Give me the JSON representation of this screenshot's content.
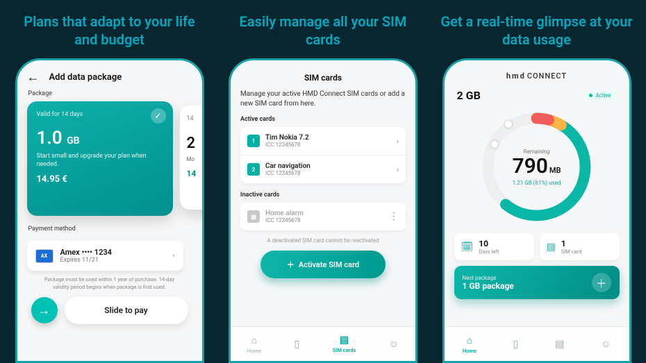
{
  "screen1": {
    "headline": "Plans that adapt to your life and budget",
    "back_icon": "←",
    "title": "Add data package",
    "package_label": "Package",
    "card_selected": {
      "valid": "Valid for 14 days",
      "size_num": "1.0",
      "size_unit": "GB",
      "desc": "Start small and upgrade your plan when needed.",
      "price": "14.95 €"
    },
    "card_peek": {
      "valid_short": "14",
      "size_num": "2",
      "desc_short": "Mo",
      "price_short": "14"
    },
    "payment_label": "Payment method",
    "payment": {
      "logo_text": "AX",
      "name": "Amex •••• 1234",
      "expires": "Expires 11/21"
    },
    "disclaimer": "Package must be used within 1 year of purchase. 14-day validity period begins when package is first used.",
    "slide_label": "Slide to pay",
    "arrow": "→"
  },
  "screen2": {
    "headline": "Easily manage all your SIM cards",
    "title": "SIM cards",
    "intro": "Manage your active HMD Connect SIM cards or add a new SIM card from here.",
    "active_label": "Active cards",
    "active": [
      {
        "idx": "1",
        "name": "Tim Nokia 7.2",
        "icc": "ICC 12345678"
      },
      {
        "idx": "2",
        "name": "Car navigation",
        "icc": "ICC 12345678"
      }
    ],
    "inactive_label": "Inactive cards",
    "inactive": [
      {
        "name": "Home alarm",
        "icc": "ICC 12345678"
      }
    ],
    "note": "A deactivated SIM card cannot be reactivated",
    "activate_label": "Activate SIM card",
    "nav": {
      "home": "Home",
      "mid1": "",
      "sim": "SIM cards",
      "profile": ""
    }
  },
  "screen3": {
    "headline": "Get a real-time glimpse at your data usage",
    "brand_bold": "hmd",
    "brand_light": "CONNECT",
    "plan_size": "2 GB",
    "status_label": "Active",
    "donut": {
      "remaining_label": "Remaining",
      "value": "790",
      "unit": "MB",
      "used_text": "1.21 GB (61%) used"
    },
    "info": {
      "days_value": "10",
      "days_label": "Days left",
      "sim_value": "1",
      "sim_label": "SIM card"
    },
    "next": {
      "title": "Next package",
      "size": "1 GB package"
    },
    "nav": {
      "home": "Home"
    }
  }
}
